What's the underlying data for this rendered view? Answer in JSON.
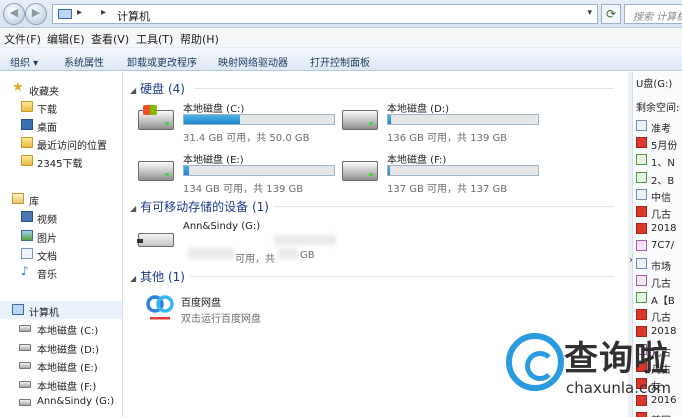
{
  "address_bar": {
    "crumbs": [
      "计算机"
    ],
    "search_placeholder": "搜索 计算机"
  },
  "menu": [
    "文件(F)",
    "编辑(E)",
    "查看(V)",
    "工具(T)",
    "帮助(H)"
  ],
  "toolbar": [
    "组织 ▾",
    "系统属性",
    "卸载或更改程序",
    "映射网络驱动器",
    "打开控制面板"
  ],
  "sidebar": {
    "favorites": {
      "header": "收藏夹",
      "items": [
        "下载",
        "桌面",
        "最近访问的位置",
        "2345下载"
      ]
    },
    "libraries": {
      "header": "库",
      "items": [
        "视频",
        "图片",
        "文档",
        "音乐"
      ]
    },
    "computer": {
      "header": "计算机",
      "items": [
        "本地磁盘 (C:)",
        "本地磁盘 (D:)",
        "本地磁盘 (E:)",
        "本地磁盘 (F:)",
        "Ann&Sindy (G:)"
      ]
    }
  },
  "groups": {
    "hard_disks": "硬盘 (4)",
    "removable": "有可移动存储的设备 (1)",
    "other": "其他 (1)"
  },
  "drives": [
    {
      "name": "本地磁盘 (C:)",
      "info": "31.4 GB 可用，共 50.0 GB",
      "used_fraction": 0.37
    },
    {
      "name": "本地磁盘 (D:)",
      "info": "136 GB 可用，共 139 GB",
      "used_fraction": 0.02
    },
    {
      "name": "本地磁盘 (E:)",
      "info": "134 GB 可用，共 139 GB",
      "used_fraction": 0.035
    },
    {
      "name": "本地磁盘 (F:)",
      "info": "137 GB 可用，共 137 GB",
      "used_fraction": 0.01
    }
  ],
  "usb": {
    "name": "Ann&Sindy (G:)",
    "info_mid": "可用，共",
    "info_unit": "GB"
  },
  "other_item": {
    "name": "百度网盘",
    "desc": "双击运行百度网盘"
  },
  "details_pane": {
    "title": "U盘(G:)",
    "free_label": "剩余空间:",
    "files": [
      "准考",
      "5月份",
      "1、N",
      "2、B",
      "中信",
      "几古",
      "2018",
      "7C7/",
      "市场",
      "几古",
      "A【B",
      "几古",
      "2018",
      "几古",
      "几古",
      "友",
      "2016",
      "首网"
    ]
  },
  "watermark": {
    "chinese": "查询啦",
    "latin": "chaxunla.com"
  },
  "colors": {
    "bar_fill": "#1f86c8",
    "group_header": "#1e3a8a",
    "watermark_blue": "#2b9be0"
  }
}
